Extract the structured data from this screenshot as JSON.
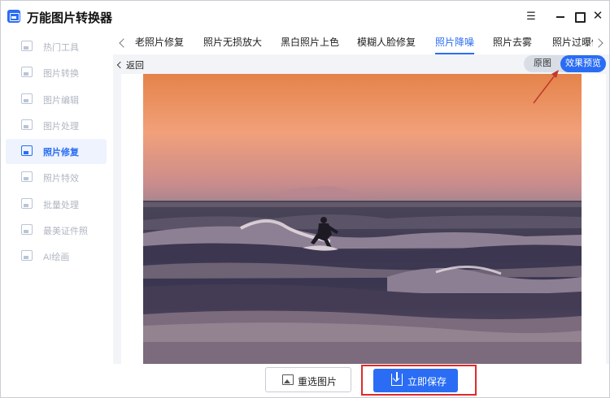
{
  "app": {
    "title": "万能图片转换器",
    "window_controls": {
      "menu": "☰",
      "close": "✕"
    }
  },
  "sidebar": {
    "items": [
      {
        "label": "热门工具",
        "icon": "grid-icon",
        "active": false
      },
      {
        "label": "图片转换",
        "icon": "image-convert-icon",
        "active": false
      },
      {
        "label": "图片编辑",
        "icon": "image-edit-icon",
        "active": false
      },
      {
        "label": "图片处理",
        "icon": "image-process-icon",
        "active": false
      },
      {
        "label": "照片修复",
        "icon": "photo-repair-icon",
        "active": true
      },
      {
        "label": "照片特效",
        "icon": "photo-effect-icon",
        "active": false
      },
      {
        "label": "批量处理",
        "icon": "batch-icon",
        "active": false
      },
      {
        "label": "最美证件照",
        "icon": "id-photo-icon",
        "active": false
      },
      {
        "label": "AI绘画",
        "icon": "ai-paint-icon",
        "active": false
      }
    ]
  },
  "tabs": [
    {
      "label": "老照片修复",
      "active": false
    },
    {
      "label": "照片无损放大",
      "active": false
    },
    {
      "label": "黑白照片上色",
      "active": false
    },
    {
      "label": "模糊人脸修复",
      "active": false
    },
    {
      "label": "照片降噪",
      "active": true
    },
    {
      "label": "照片去雾",
      "active": false
    },
    {
      "label": "照片过曝修复",
      "active": false
    }
  ],
  "subbar": {
    "back_label": "返回",
    "toggle": {
      "original": "原图",
      "effect": "效果预览",
      "selected": "效果预览"
    }
  },
  "footer": {
    "reselect_label": "重选图片",
    "save_label": "立即保存"
  },
  "colors": {
    "accent": "#2a6df4",
    "annotation": "#e02a2a",
    "sky_top": "#e98a4e",
    "sky_mid": "#f3a27a",
    "sea": "#3a3a52"
  }
}
